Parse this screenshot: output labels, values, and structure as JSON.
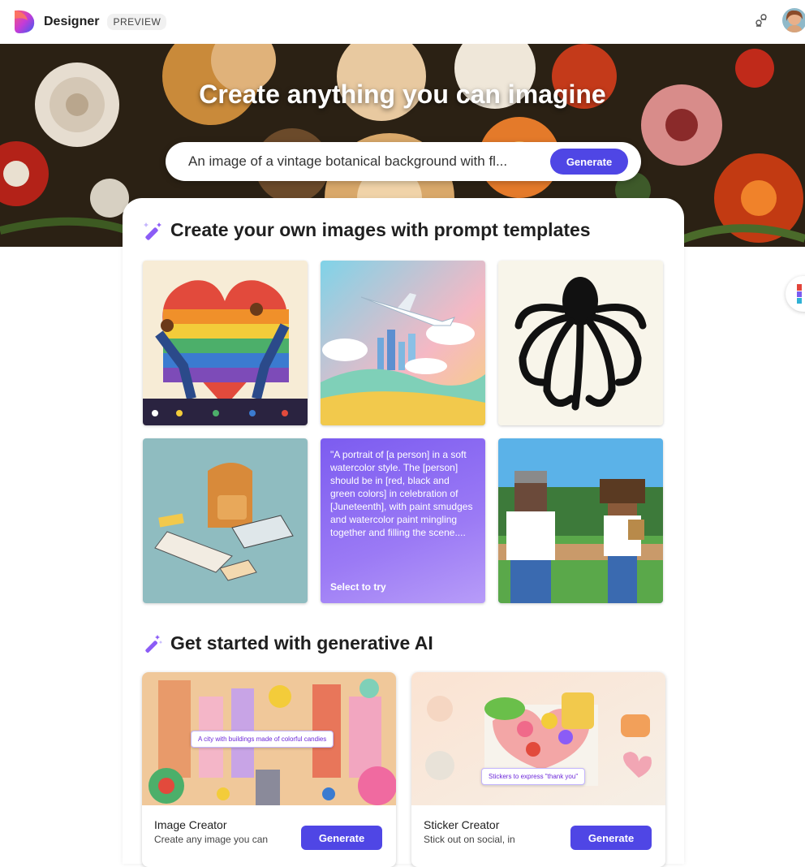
{
  "header": {
    "brand": "Designer",
    "badge": "PREVIEW",
    "icons": {
      "logo": "designer-logo-icon",
      "share": "share-icon",
      "avatar": "user-avatar"
    }
  },
  "hero": {
    "title": "Create anything you can imagine",
    "prompt_value": "An image of a vintage botanical background with fl...",
    "generate_label": "Generate"
  },
  "templates": {
    "title": "Create your own images with prompt templates",
    "text_tile": {
      "text": "\"A portrait of [a person] in a soft watercolor style. The [person] should be in [red, black and green colors] in celebration of [Juneteenth], with paint smudges and watercolor paint mingling together and filling the scene....",
      "cta": "Select to try"
    }
  },
  "generative": {
    "title": "Get started with generative AI",
    "cards": [
      {
        "label": "Image Creator",
        "sub": "Create any image you can",
        "button": "Generate",
        "prompt": "A city with buildings made of colorful candies"
      },
      {
        "label": "Sticker Creator",
        "sub": "Stick out on social, in",
        "button": "Generate",
        "prompt": "Stickers to express \"thank you\""
      }
    ]
  },
  "colors": {
    "accent": "#4f46e5"
  }
}
